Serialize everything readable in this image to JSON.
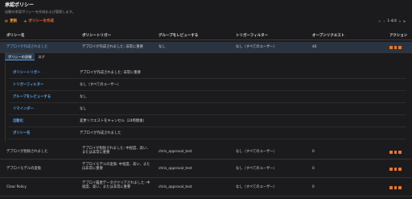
{
  "header": {
    "title": "承認ポリシー",
    "subtitle": "自動の承認ポリシーを作成および管理します。"
  },
  "toolbar": {
    "refresh_label": "更新",
    "create_label": "ポリシーを作成"
  },
  "pager": {
    "range": "1-4/4"
  },
  "table": {
    "columns": [
      "ポリシー名",
      "ポリシートリガー",
      "グループをレビューする",
      "トリガーフィルター",
      "オープンリクエスト",
      "アクション"
    ],
    "rows": [
      {
        "name": "デプロイが作成されました",
        "trigger": "デプロイが作成されました: 非常に重要",
        "group": "なし",
        "filter": "なし（すべてのユーザー）",
        "open": "46"
      },
      {
        "name": "デプロイが削除されました",
        "trigger": "デプロイが削除されました: 中程度、高い、または非常に重要",
        "group": "chris_approval_test",
        "filter": "なし（すべてのユーザー）",
        "open": "0"
      },
      {
        "name": "デプロイモデルの変換",
        "trigger": "デプロイモデルの変換: 中程度、高い、または非常に重要",
        "group": "chris_approval_test",
        "filter": "なし（すべてのユーザー）",
        "open": "0"
      },
      {
        "name": "Clear Policy",
        "trigger": "デプロイ履歴データがクリアされました: 中程度、高い、または非常に重要",
        "group": "chris_approval_test",
        "filter": "なし（すべてのユーザー）",
        "open": "0"
      }
    ]
  },
  "detail": {
    "tabs": [
      "ポリシーの詳細",
      "ログ"
    ],
    "fields": [
      {
        "label": "ポリシートリガー",
        "value": "デプロイが作成されました: 非常に重要"
      },
      {
        "label": "トリガーフィルター",
        "value": "なし（すべてのユーザー）"
      },
      {
        "label": "グループをレビューする",
        "value": "なし"
      },
      {
        "label": "リマインダー",
        "value": "なし"
      },
      {
        "label": "自動化",
        "value": "変更リクエストをキャンセル（24時間後）"
      },
      {
        "label": "ポリシー名",
        "value": "デプロイが作成されました"
      }
    ]
  },
  "icons": {
    "refresh": "refresh-icon",
    "create": "plus-icon",
    "edit": "edit-icon",
    "copy": "copy-icon",
    "delete": "delete-icon"
  },
  "colors": {
    "accent": "#e8772e",
    "link": "#5ea6ee",
    "selected_row": "#2a3440"
  }
}
